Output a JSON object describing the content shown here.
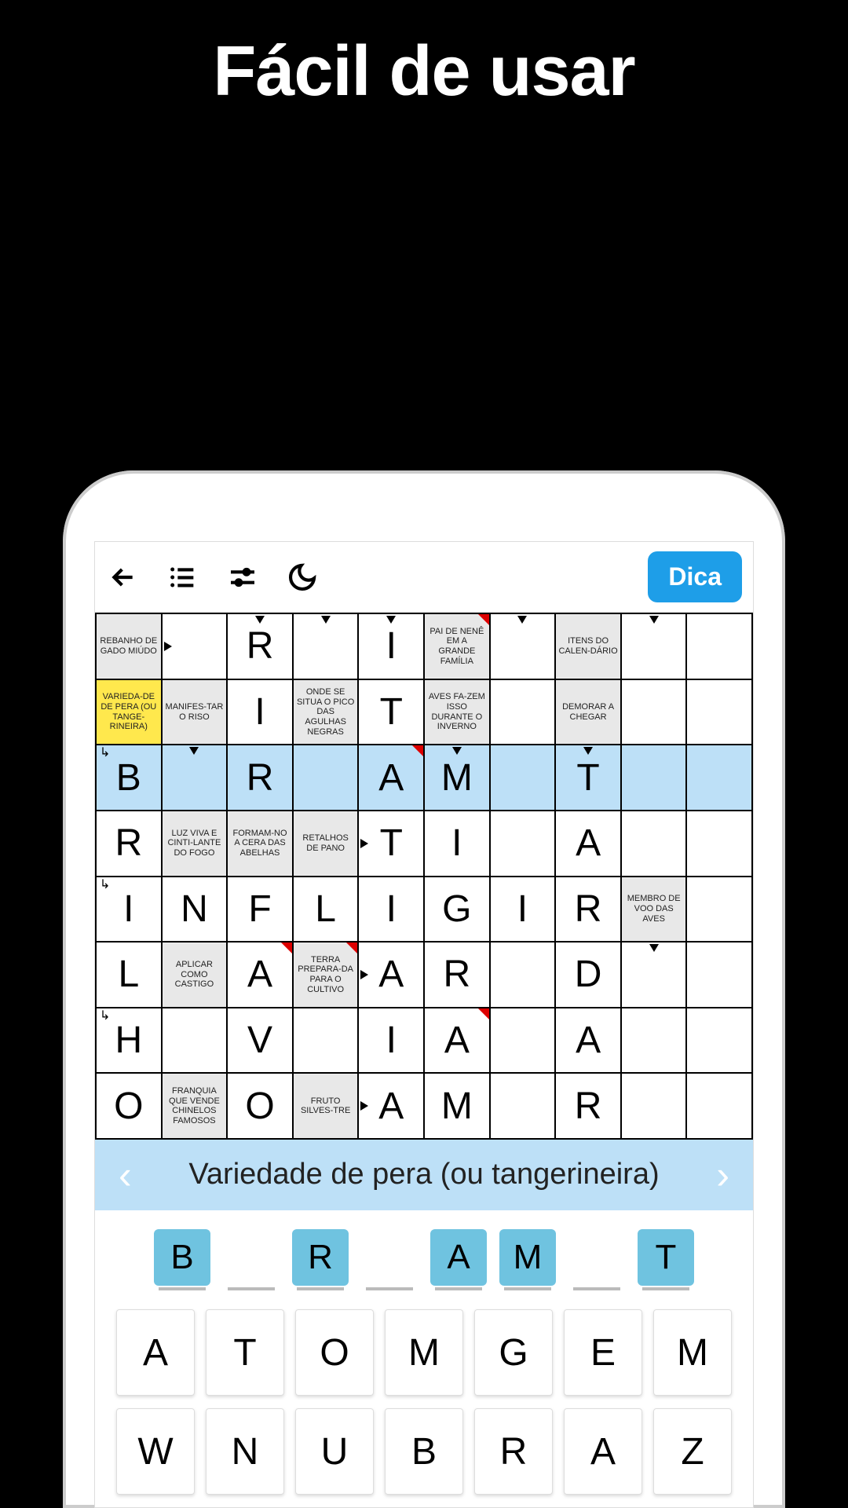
{
  "headline": "Fácil de usar",
  "toolbar": {
    "hint": "Dica"
  },
  "clue_bar": {
    "text": "Variedade de pera (ou tangerineira)"
  },
  "grid": [
    [
      {
        "t": "clue",
        "txt": "REBANHO DE GADO MIÚDO"
      },
      {
        "t": "letter",
        "txt": "",
        "arrow": "r"
      },
      {
        "t": "letter",
        "txt": "R",
        "arrow": "d"
      },
      {
        "t": "letter",
        "txt": "",
        "arrow": "d"
      },
      {
        "t": "letter",
        "txt": "I",
        "arrow": "d"
      },
      {
        "t": "clue",
        "txt": "PAI DE NENÊ EM A GRANDE FAMÍLIA",
        "red": true
      },
      {
        "t": "letter",
        "txt": "",
        "arrow": "d"
      },
      {
        "t": "clue",
        "txt": "ITENS DO CALEN-DÁRIO"
      },
      {
        "t": "letter",
        "txt": "",
        "arrow": "d"
      },
      {
        "t": "letter",
        "txt": ""
      }
    ],
    [
      {
        "t": "clue",
        "txt": "VARIEDA-DE DE PERA (OU TANGE-RINEIRA)",
        "active": true
      },
      {
        "t": "clue",
        "txt": "MANIFES-TAR O RISO"
      },
      {
        "t": "letter",
        "txt": "I"
      },
      {
        "t": "clue",
        "txt": "ONDE SE SITUA O PICO DAS AGULHAS NEGRAS"
      },
      {
        "t": "letter",
        "txt": "T"
      },
      {
        "t": "clue",
        "txt": "AVES FA-ZEM ISSO DURANTE O INVERNO"
      },
      {
        "t": "letter",
        "txt": ""
      },
      {
        "t": "clue",
        "txt": "DEMORAR A CHEGAR"
      },
      {
        "t": "letter",
        "txt": ""
      },
      {
        "t": "letter",
        "txt": ""
      }
    ],
    [
      {
        "t": "letter",
        "txt": "B",
        "hl": true,
        "arrow": "dr"
      },
      {
        "t": "letter",
        "txt": "",
        "hl": true,
        "arrow": "d"
      },
      {
        "t": "letter",
        "txt": "R",
        "hl": true
      },
      {
        "t": "letter",
        "txt": "",
        "hl": true
      },
      {
        "t": "letter",
        "txt": "A",
        "hl": true,
        "red": true
      },
      {
        "t": "letter",
        "txt": "M",
        "hl": true,
        "arrow": "d"
      },
      {
        "t": "letter",
        "txt": "",
        "hl": true
      },
      {
        "t": "letter",
        "txt": "T",
        "hl": true,
        "arrow": "d"
      },
      {
        "t": "letter",
        "txt": "",
        "hl": true
      },
      {
        "t": "letter",
        "txt": "",
        "hl": true
      }
    ],
    [
      {
        "t": "letter",
        "txt": "R"
      },
      {
        "t": "clue",
        "txt": "LUZ VIVA E CINTI-LANTE DO FOGO"
      },
      {
        "t": "clue",
        "txt": "FORMAM-NO A CERA DAS ABELHAS"
      },
      {
        "t": "clue",
        "txt": "RETALHOS DE PANO"
      },
      {
        "t": "letter",
        "txt": "T",
        "arrow": "r"
      },
      {
        "t": "letter",
        "txt": "I"
      },
      {
        "t": "letter",
        "txt": ""
      },
      {
        "t": "letter",
        "txt": "A"
      },
      {
        "t": "letter",
        "txt": ""
      },
      {
        "t": "letter",
        "txt": ""
      }
    ],
    [
      {
        "t": "letter",
        "txt": "I",
        "arrow": "dr"
      },
      {
        "t": "letter",
        "txt": "N"
      },
      {
        "t": "letter",
        "txt": "F"
      },
      {
        "t": "letter",
        "txt": "L"
      },
      {
        "t": "letter",
        "txt": "I"
      },
      {
        "t": "letter",
        "txt": "G"
      },
      {
        "t": "letter",
        "txt": "I"
      },
      {
        "t": "letter",
        "txt": "R"
      },
      {
        "t": "clue",
        "txt": "MEMBRO DE VOO DAS AVES"
      },
      {
        "t": "letter",
        "txt": ""
      }
    ],
    [
      {
        "t": "letter",
        "txt": "L"
      },
      {
        "t": "clue",
        "txt": "APLICAR COMO CASTIGO"
      },
      {
        "t": "letter",
        "txt": "A",
        "red": true
      },
      {
        "t": "clue",
        "txt": "TERRA PREPARA-DA PARA O CULTIVO",
        "red": true
      },
      {
        "t": "letter",
        "txt": "A",
        "arrow": "r"
      },
      {
        "t": "letter",
        "txt": "R"
      },
      {
        "t": "letter",
        "txt": ""
      },
      {
        "t": "letter",
        "txt": "D"
      },
      {
        "t": "letter",
        "txt": "",
        "arrow": "d"
      },
      {
        "t": "letter",
        "txt": ""
      }
    ],
    [
      {
        "t": "letter",
        "txt": "H",
        "arrow": "dr"
      },
      {
        "t": "letter",
        "txt": ""
      },
      {
        "t": "letter",
        "txt": "V"
      },
      {
        "t": "letter",
        "txt": ""
      },
      {
        "t": "letter",
        "txt": "I"
      },
      {
        "t": "letter",
        "txt": "A",
        "red": true
      },
      {
        "t": "letter",
        "txt": ""
      },
      {
        "t": "letter",
        "txt": "A"
      },
      {
        "t": "letter",
        "txt": ""
      },
      {
        "t": "letter",
        "txt": ""
      }
    ],
    [
      {
        "t": "letter",
        "txt": "O"
      },
      {
        "t": "clue",
        "txt": "FRANQUIA QUE VENDE CHINELOS FAMOSOS"
      },
      {
        "t": "letter",
        "txt": "O"
      },
      {
        "t": "clue",
        "txt": "FRUTO SILVES-TRE"
      },
      {
        "t": "letter",
        "txt": "A",
        "arrow": "r"
      },
      {
        "t": "letter",
        "txt": "M"
      },
      {
        "t": "letter",
        "txt": ""
      },
      {
        "t": "letter",
        "txt": "R"
      },
      {
        "t": "letter",
        "txt": ""
      },
      {
        "t": "letter",
        "txt": ""
      }
    ]
  ],
  "answer_slots": [
    {
      "l": "B",
      "f": true
    },
    {
      "l": "",
      "f": false
    },
    {
      "l": "R",
      "f": true
    },
    {
      "l": "",
      "f": false
    },
    {
      "l": "A",
      "f": true
    },
    {
      "l": "M",
      "f": true
    },
    {
      "l": "",
      "f": false
    },
    {
      "l": "T",
      "f": true
    }
  ],
  "keyboard": [
    [
      "A",
      "T",
      "O",
      "M",
      "G",
      "E",
      "M"
    ],
    [
      "W",
      "N",
      "U",
      "B",
      "R",
      "A",
      "Z"
    ]
  ]
}
